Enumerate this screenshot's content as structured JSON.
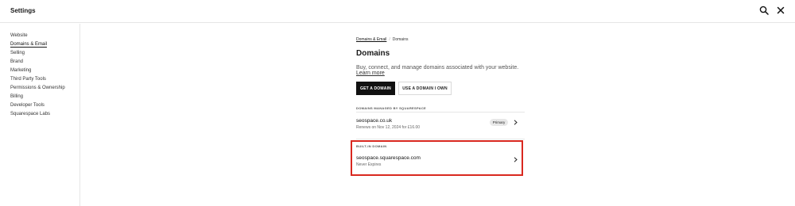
{
  "header": {
    "title": "Settings",
    "search_icon": "search-icon",
    "close_icon": "close-icon"
  },
  "sidebar": {
    "items": [
      {
        "label": "Website"
      },
      {
        "label": "Domains & Email",
        "active": true
      },
      {
        "label": "Selling"
      },
      {
        "label": "Brand"
      },
      {
        "label": "Marketing"
      },
      {
        "label": "Third Party Tools"
      },
      {
        "label": "Permissions & Ownership"
      },
      {
        "label": "Billing"
      },
      {
        "label": "Developer Tools"
      },
      {
        "label": "Squarespace Labs"
      }
    ]
  },
  "main": {
    "breadcrumb": {
      "parent": "Domains & Email",
      "separator": "/",
      "current": "Domains"
    },
    "title": "Domains",
    "description": "Buy, connect, and manage domains associated with your website.",
    "learn_more": "Learn more",
    "buttons": {
      "get_domain": "GET A DOMAIN",
      "use_domain": "USE A DOMAIN I OWN"
    },
    "managed_section": {
      "label": "DOMAINS MANAGED BY SQUARESPACE",
      "domain": {
        "name": "seospace.co.uk",
        "sub": "Renews on Nov 12, 2024 for £16.00",
        "badge": "Primary"
      }
    },
    "builtin_section": {
      "label": "BUILT-IN DOMAIN",
      "domain": {
        "name": "seospace.squarespace.com",
        "sub": "Never Expires"
      }
    }
  },
  "colors": {
    "highlight": "#d9281f",
    "primary_button": "#111111"
  }
}
